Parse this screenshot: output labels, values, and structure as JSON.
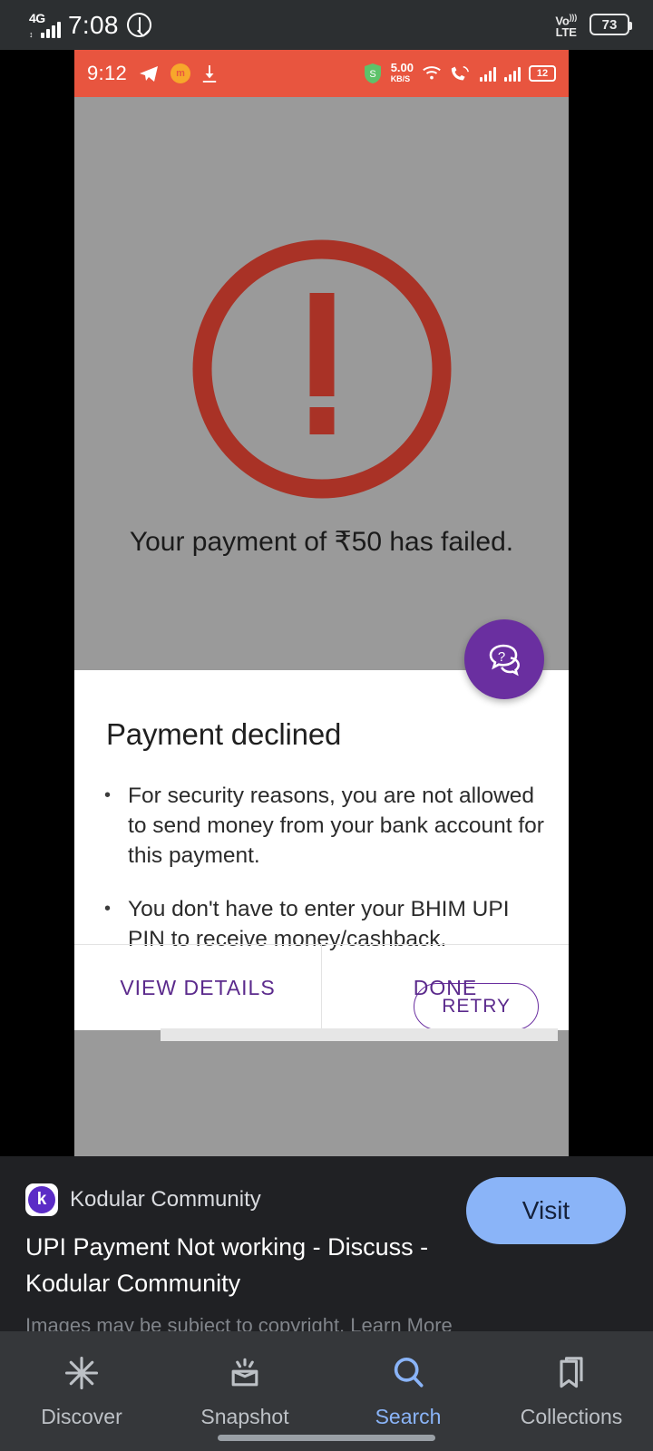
{
  "os_status_bar": {
    "network_type": "4G",
    "time": "7:08",
    "dnd_icon": "do-not-disturb-icon",
    "volte_label": "VoLTE",
    "battery_percent": "73"
  },
  "app_status_bar": {
    "time": "9:12",
    "telegram_icon": "telegram-icon",
    "app_badge_icon": "app-badge-icon",
    "download_icon": "download-icon",
    "shield_icon": "security-shield-icon",
    "net_speed": "5.00",
    "net_speed_unit": "KB/S",
    "wifi_icon": "wifi-icon",
    "call_icon": "call-signal-icon",
    "battery_percent": "12",
    "background_color": "#e8553f"
  },
  "payment_screen": {
    "warning_icon": "exclamation-circle-icon",
    "warning_color": "#a93226",
    "failure_message": "Your payment of ₹50 has failed.",
    "help_fab": "help-chat-icon",
    "help_fab_color": "#6a2fa0",
    "sheet": {
      "title": "Payment declined",
      "bullets": [
        "For security reasons, you are not allowed to send money from your bank account for this payment.",
        "You don't have to enter your BHIM UPI PIN to receive money/cashback."
      ],
      "retry_label": "RETRY",
      "view_details_label": "VIEW DETAILS",
      "done_label": "DONE",
      "accent_color": "#5b2a8c"
    }
  },
  "attribution": {
    "favicon": "kodular-logo-icon",
    "site_name": "Kodular Community",
    "title": "UPI Payment Not working - Discuss - Kodular Community",
    "copyright_notice": "Images may be subject to copyright. Learn More",
    "visit_label": "Visit",
    "visit_color": "#8ab4f8"
  },
  "bottom_nav": {
    "items": [
      {
        "label": "Discover",
        "icon": "discover-asterisk-icon",
        "active": false
      },
      {
        "label": "Snapshot",
        "icon": "snapshot-lens-icon",
        "active": false
      },
      {
        "label": "Search",
        "icon": "search-magnifier-icon",
        "active": true
      },
      {
        "label": "Collections",
        "icon": "bookmark-stack-icon",
        "active": false
      }
    ],
    "active_color": "#8ab4f8",
    "inactive_color": "#bdc1c6"
  }
}
